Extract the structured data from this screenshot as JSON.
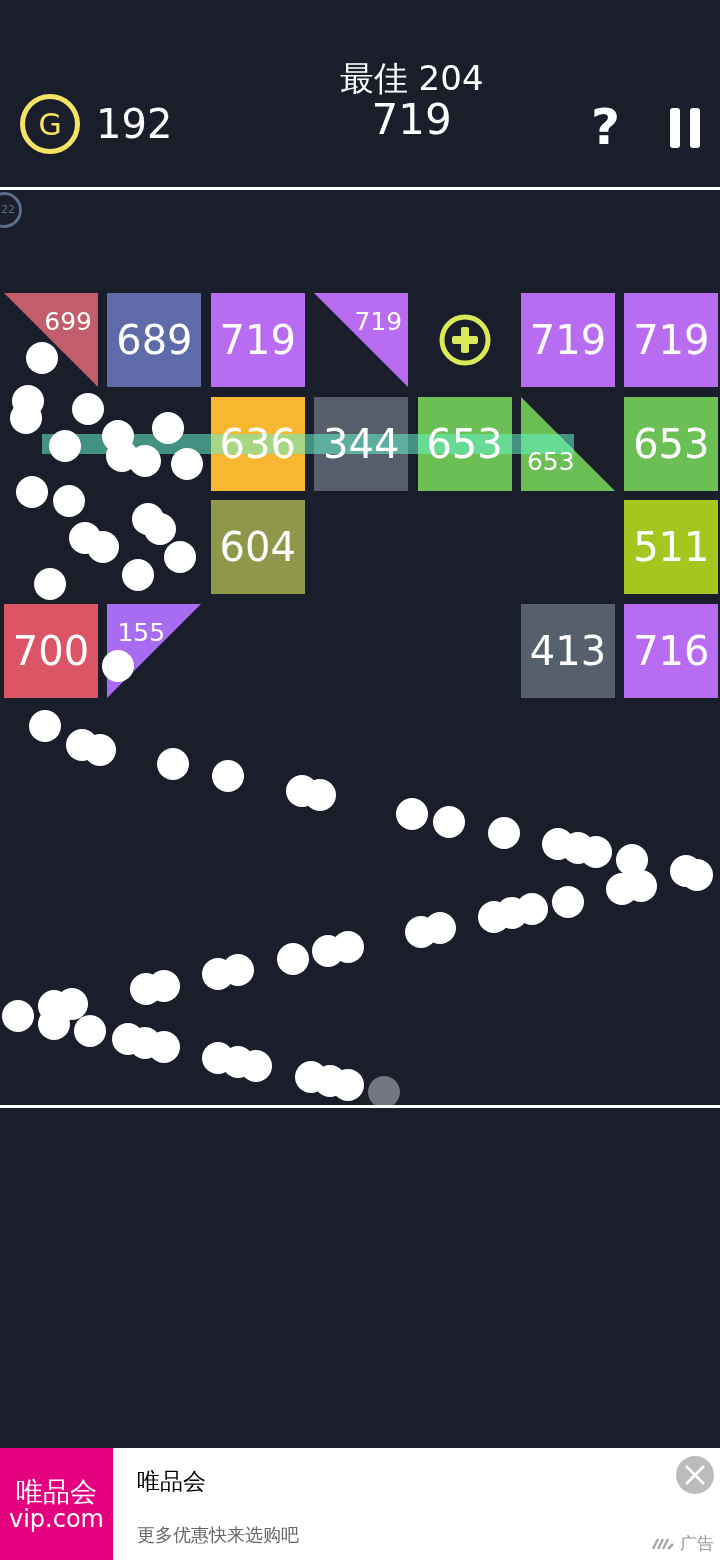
{
  "header": {
    "coin_symbol": "G",
    "coins": "192",
    "best": "最佳 204",
    "score": "719",
    "help": "?"
  },
  "level_badge": "22",
  "tile_rows": [
    [
      {
        "kind": "corner_tr",
        "value": "699",
        "color": "#c25e6b"
      },
      {
        "kind": "square",
        "value": "689",
        "color": "#5f6aa8"
      },
      {
        "kind": "square",
        "value": "719",
        "color": "#b86cf2"
      },
      {
        "kind": "corner_tr",
        "value": "719",
        "color": "#b86cf2"
      },
      {
        "kind": "plus"
      },
      {
        "kind": "square",
        "value": "719",
        "color": "#b86cf2"
      },
      {
        "kind": "square",
        "value": "719",
        "color": "#b86cf2"
      }
    ],
    [
      {
        "kind": "empty"
      },
      {
        "kind": "empty"
      },
      {
        "kind": "square",
        "value": "636",
        "color": "#f8b731"
      },
      {
        "kind": "square",
        "value": "344",
        "color": "#565e6c"
      },
      {
        "kind": "square",
        "value": "653",
        "color": "#6cbf55"
      },
      {
        "kind": "corner_bl",
        "value": "653",
        "color": "#6cbf55"
      },
      {
        "kind": "square",
        "value": "653",
        "color": "#6cbf55"
      }
    ],
    [
      {
        "kind": "empty"
      },
      {
        "kind": "empty"
      },
      {
        "kind": "square",
        "value": "604",
        "color": "#8f984a"
      },
      {
        "kind": "empty"
      },
      {
        "kind": "empty"
      },
      {
        "kind": "empty"
      },
      {
        "kind": "square",
        "value": "511",
        "color": "#a5c61f"
      }
    ],
    [
      {
        "kind": "square",
        "value": "700",
        "color": "#dc5565"
      },
      {
        "kind": "corner_tl",
        "value": "155",
        "color": "#a86cf2"
      },
      {
        "kind": "empty"
      },
      {
        "kind": "empty"
      },
      {
        "kind": "empty"
      },
      {
        "kind": "square",
        "value": "413",
        "color": "#56606c"
      },
      {
        "kind": "square",
        "value": "716",
        "color": "#b86cf2"
      }
    ]
  ],
  "ad": {
    "logo_name": "唯品会",
    "logo_domain": "vip.com",
    "title": "唯品会",
    "text": "更多优惠快来选购吧",
    "label": "广告"
  }
}
